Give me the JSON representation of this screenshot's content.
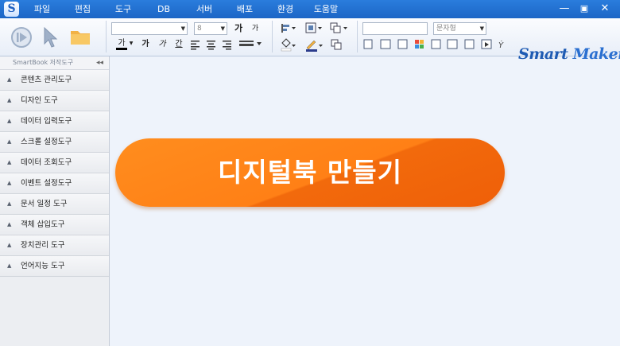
{
  "app": {
    "icon_letter": "S"
  },
  "menu": [
    "파일",
    "편집",
    "도구",
    "DB",
    "서버",
    "배포",
    "환경",
    "도움말"
  ],
  "window_controls": {
    "minimize": "—",
    "restore": "▣",
    "close": "✕"
  },
  "toolbar": {
    "font_size": "8",
    "text_style_combo": "문자형",
    "format_glyphs": [
      "가",
      "가",
      "가",
      "간"
    ],
    "bold_glyph": "가",
    "superscript_glyph": "가"
  },
  "logo": {
    "part1": "Smart",
    "part2": "Maker"
  },
  "sidebar": {
    "header": "SmartBook 저작도구",
    "collapse": "◂◂",
    "items": [
      {
        "label": "콘텐츠 관리도구"
      },
      {
        "label": "디자인 도구"
      },
      {
        "label": "데이터 입력도구"
      },
      {
        "label": "스크롤 설정도구"
      },
      {
        "label": "데이터 조회도구"
      },
      {
        "label": "이벤트 설정도구"
      },
      {
        "label": "문서 일정 도구"
      },
      {
        "label": "객체 삽입도구"
      },
      {
        "label": "장치관리 도구"
      },
      {
        "label": "언어지능 도구"
      }
    ]
  },
  "banner": {
    "text": "디지털북 만들기"
  },
  "colors": {
    "menubar": "#1f6fd0",
    "banner": "#ff7a14",
    "logo": "#1e5bb3"
  }
}
